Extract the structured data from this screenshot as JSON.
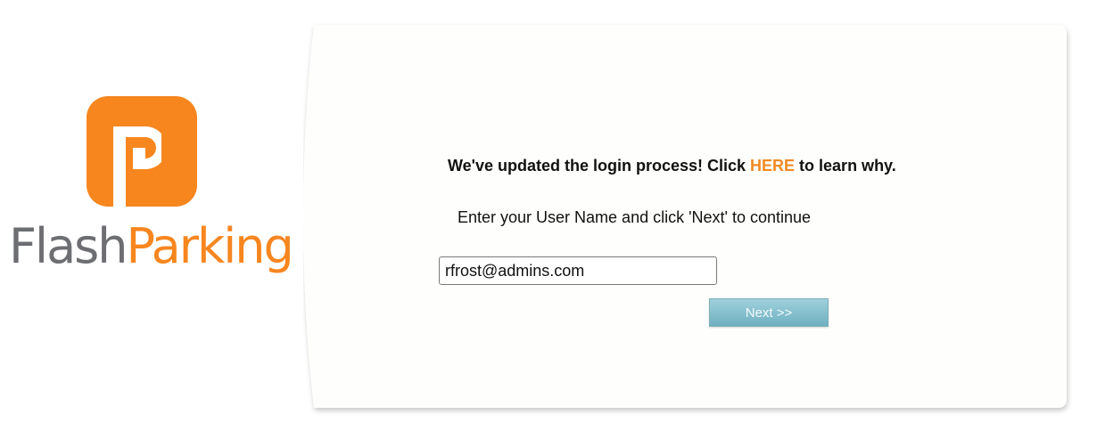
{
  "brand": {
    "logo_icon": "flashparking-logo-icon",
    "name_part1": "Flash",
    "name_part2": "Parking",
    "colors": {
      "orange": "#f7861f",
      "gray": "#6d6e71"
    }
  },
  "login": {
    "notice_prefix": "We've updated the login process! Click ",
    "notice_link": "HERE",
    "notice_suffix": " to learn why.",
    "instruction": "Enter your User Name and click 'Next' to continue",
    "username_value": "rfrost@admins.com",
    "next_button_label": "Next >>",
    "link_color": "#ef8a22",
    "button_color": "#7fbccc"
  }
}
